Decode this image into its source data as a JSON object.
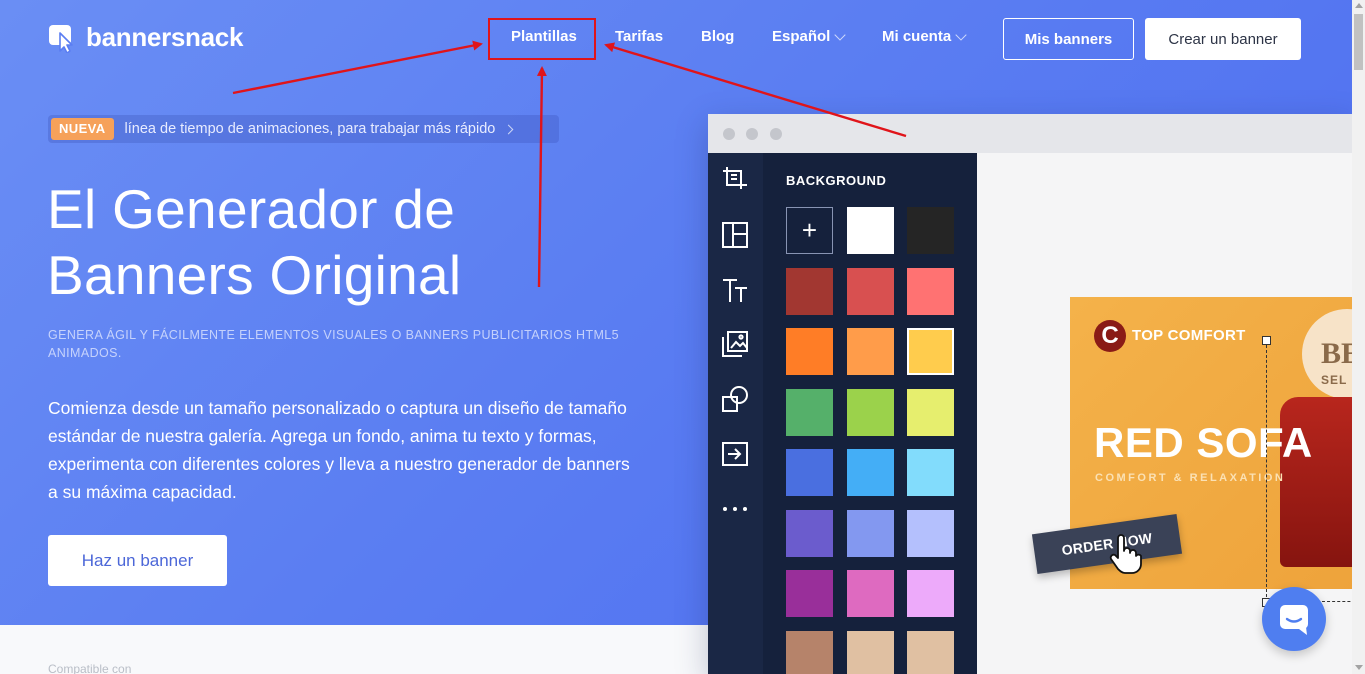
{
  "brand": {
    "name": "bannersnack"
  },
  "nav": {
    "items": [
      {
        "label": "Plantillas"
      },
      {
        "label": "Tarifas"
      },
      {
        "label": "Blog"
      },
      {
        "label": "Español"
      },
      {
        "label": "Mi cuenta"
      }
    ],
    "my_banners": "Mis banners",
    "create_banner": "Crear un banner"
  },
  "announcement": {
    "badge": "NUEVA",
    "text": "línea de tiempo de animaciones, para trabajar más rápido"
  },
  "hero": {
    "title_line1": "El Generador de",
    "title_line2": "Banners Original",
    "subtitle": "GENERA ÁGIL Y FÁCILMENTE ELEMENTOS VISUALES O BANNERS PUBLICITARIOS HTML5 ANIMADOS.",
    "description": "Comienza desde un tamaño personalizado o captura un diseño de tamaño estándar de nuestra galería. Agrega un fondo, anima tu texto y formas, experimenta con diferentes colores y lleva a nuestro generador de banners a su máxima capacidad.",
    "cta": "Haz un banner"
  },
  "editor": {
    "panel_title": "BACKGROUND",
    "add_symbol": "+",
    "swatches": [
      "#ffffff",
      "#252525",
      "#a23731",
      "#d85050",
      "#ff7272",
      "#ff7d26",
      "#ff9c4a",
      "#ffcc4d",
      "#55b06a",
      "#9bd24b",
      "#e6ee6e",
      "#4a6fe0",
      "#44aef6",
      "#82dcfc",
      "#6b5ccd",
      "#8398f0",
      "#b4c0fd",
      "#992f9a",
      "#de6ac0",
      "#edaafa",
      "#b6836a",
      "#e0c0a2",
      "#e0c0a2"
    ],
    "selected_swatch": "#ffcc4d",
    "rail_icons": [
      "crop-icon",
      "layout-icon",
      "text-icon",
      "images-icon",
      "shapes-icon",
      "export-icon",
      "more-icon"
    ]
  },
  "ad": {
    "logo_letter": "C",
    "brand": "TOP COMFORT",
    "title": "RED SOFA",
    "tagline": "COMFORT & RELAXATION",
    "cta": "ORDER NOW",
    "seal_line1": "BE",
    "seal_line2": "SEL"
  },
  "footer": {
    "compatible": "Compatible con"
  },
  "colors": {
    "hero_start": "#6a8ef4",
    "hero_end": "#4c6cf0",
    "badge": "#f6a15a",
    "highlight_red": "#e0141a",
    "editor_panel": "#15213c"
  }
}
